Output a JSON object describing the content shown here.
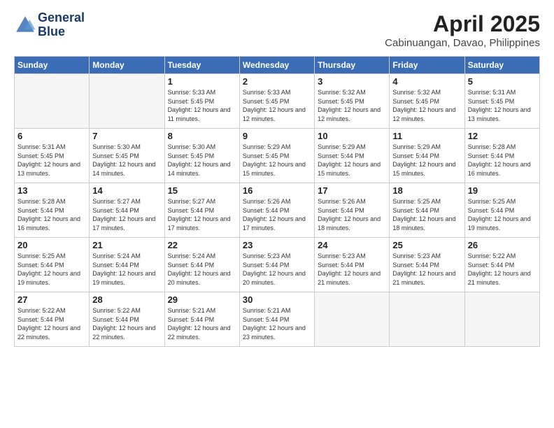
{
  "header": {
    "logo_line1": "General",
    "logo_line2": "Blue",
    "month_year": "April 2025",
    "location": "Cabinuangan, Davao, Philippines"
  },
  "weekdays": [
    "Sunday",
    "Monday",
    "Tuesday",
    "Wednesday",
    "Thursday",
    "Friday",
    "Saturday"
  ],
  "weeks": [
    [
      {
        "day": "",
        "sunrise": "",
        "sunset": "",
        "daylight": ""
      },
      {
        "day": "",
        "sunrise": "",
        "sunset": "",
        "daylight": ""
      },
      {
        "day": "1",
        "sunrise": "Sunrise: 5:33 AM",
        "sunset": "Sunset: 5:45 PM",
        "daylight": "Daylight: 12 hours and 11 minutes."
      },
      {
        "day": "2",
        "sunrise": "Sunrise: 5:33 AM",
        "sunset": "Sunset: 5:45 PM",
        "daylight": "Daylight: 12 hours and 12 minutes."
      },
      {
        "day": "3",
        "sunrise": "Sunrise: 5:32 AM",
        "sunset": "Sunset: 5:45 PM",
        "daylight": "Daylight: 12 hours and 12 minutes."
      },
      {
        "day": "4",
        "sunrise": "Sunrise: 5:32 AM",
        "sunset": "Sunset: 5:45 PM",
        "daylight": "Daylight: 12 hours and 12 minutes."
      },
      {
        "day": "5",
        "sunrise": "Sunrise: 5:31 AM",
        "sunset": "Sunset: 5:45 PM",
        "daylight": "Daylight: 12 hours and 13 minutes."
      }
    ],
    [
      {
        "day": "6",
        "sunrise": "Sunrise: 5:31 AM",
        "sunset": "Sunset: 5:45 PM",
        "daylight": "Daylight: 12 hours and 13 minutes."
      },
      {
        "day": "7",
        "sunrise": "Sunrise: 5:30 AM",
        "sunset": "Sunset: 5:45 PM",
        "daylight": "Daylight: 12 hours and 14 minutes."
      },
      {
        "day": "8",
        "sunrise": "Sunrise: 5:30 AM",
        "sunset": "Sunset: 5:45 PM",
        "daylight": "Daylight: 12 hours and 14 minutes."
      },
      {
        "day": "9",
        "sunrise": "Sunrise: 5:29 AM",
        "sunset": "Sunset: 5:45 PM",
        "daylight": "Daylight: 12 hours and 15 minutes."
      },
      {
        "day": "10",
        "sunrise": "Sunrise: 5:29 AM",
        "sunset": "Sunset: 5:44 PM",
        "daylight": "Daylight: 12 hours and 15 minutes."
      },
      {
        "day": "11",
        "sunrise": "Sunrise: 5:29 AM",
        "sunset": "Sunset: 5:44 PM",
        "daylight": "Daylight: 12 hours and 15 minutes."
      },
      {
        "day": "12",
        "sunrise": "Sunrise: 5:28 AM",
        "sunset": "Sunset: 5:44 PM",
        "daylight": "Daylight: 12 hours and 16 minutes."
      }
    ],
    [
      {
        "day": "13",
        "sunrise": "Sunrise: 5:28 AM",
        "sunset": "Sunset: 5:44 PM",
        "daylight": "Daylight: 12 hours and 16 minutes."
      },
      {
        "day": "14",
        "sunrise": "Sunrise: 5:27 AM",
        "sunset": "Sunset: 5:44 PM",
        "daylight": "Daylight: 12 hours and 17 minutes."
      },
      {
        "day": "15",
        "sunrise": "Sunrise: 5:27 AM",
        "sunset": "Sunset: 5:44 PM",
        "daylight": "Daylight: 12 hours and 17 minutes."
      },
      {
        "day": "16",
        "sunrise": "Sunrise: 5:26 AM",
        "sunset": "Sunset: 5:44 PM",
        "daylight": "Daylight: 12 hours and 17 minutes."
      },
      {
        "day": "17",
        "sunrise": "Sunrise: 5:26 AM",
        "sunset": "Sunset: 5:44 PM",
        "daylight": "Daylight: 12 hours and 18 minutes."
      },
      {
        "day": "18",
        "sunrise": "Sunrise: 5:25 AM",
        "sunset": "Sunset: 5:44 PM",
        "daylight": "Daylight: 12 hours and 18 minutes."
      },
      {
        "day": "19",
        "sunrise": "Sunrise: 5:25 AM",
        "sunset": "Sunset: 5:44 PM",
        "daylight": "Daylight: 12 hours and 19 minutes."
      }
    ],
    [
      {
        "day": "20",
        "sunrise": "Sunrise: 5:25 AM",
        "sunset": "Sunset: 5:44 PM",
        "daylight": "Daylight: 12 hours and 19 minutes."
      },
      {
        "day": "21",
        "sunrise": "Sunrise: 5:24 AM",
        "sunset": "Sunset: 5:44 PM",
        "daylight": "Daylight: 12 hours and 19 minutes."
      },
      {
        "day": "22",
        "sunrise": "Sunrise: 5:24 AM",
        "sunset": "Sunset: 5:44 PM",
        "daylight": "Daylight: 12 hours and 20 minutes."
      },
      {
        "day": "23",
        "sunrise": "Sunrise: 5:23 AM",
        "sunset": "Sunset: 5:44 PM",
        "daylight": "Daylight: 12 hours and 20 minutes."
      },
      {
        "day": "24",
        "sunrise": "Sunrise: 5:23 AM",
        "sunset": "Sunset: 5:44 PM",
        "daylight": "Daylight: 12 hours and 21 minutes."
      },
      {
        "day": "25",
        "sunrise": "Sunrise: 5:23 AM",
        "sunset": "Sunset: 5:44 PM",
        "daylight": "Daylight: 12 hours and 21 minutes."
      },
      {
        "day": "26",
        "sunrise": "Sunrise: 5:22 AM",
        "sunset": "Sunset: 5:44 PM",
        "daylight": "Daylight: 12 hours and 21 minutes."
      }
    ],
    [
      {
        "day": "27",
        "sunrise": "Sunrise: 5:22 AM",
        "sunset": "Sunset: 5:44 PM",
        "daylight": "Daylight: 12 hours and 22 minutes."
      },
      {
        "day": "28",
        "sunrise": "Sunrise: 5:22 AM",
        "sunset": "Sunset: 5:44 PM",
        "daylight": "Daylight: 12 hours and 22 minutes."
      },
      {
        "day": "29",
        "sunrise": "Sunrise: 5:21 AM",
        "sunset": "Sunset: 5:44 PM",
        "daylight": "Daylight: 12 hours and 22 minutes."
      },
      {
        "day": "30",
        "sunrise": "Sunrise: 5:21 AM",
        "sunset": "Sunset: 5:44 PM",
        "daylight": "Daylight: 12 hours and 23 minutes."
      },
      {
        "day": "",
        "sunrise": "",
        "sunset": "",
        "daylight": ""
      },
      {
        "day": "",
        "sunrise": "",
        "sunset": "",
        "daylight": ""
      },
      {
        "day": "",
        "sunrise": "",
        "sunset": "",
        "daylight": ""
      }
    ]
  ]
}
